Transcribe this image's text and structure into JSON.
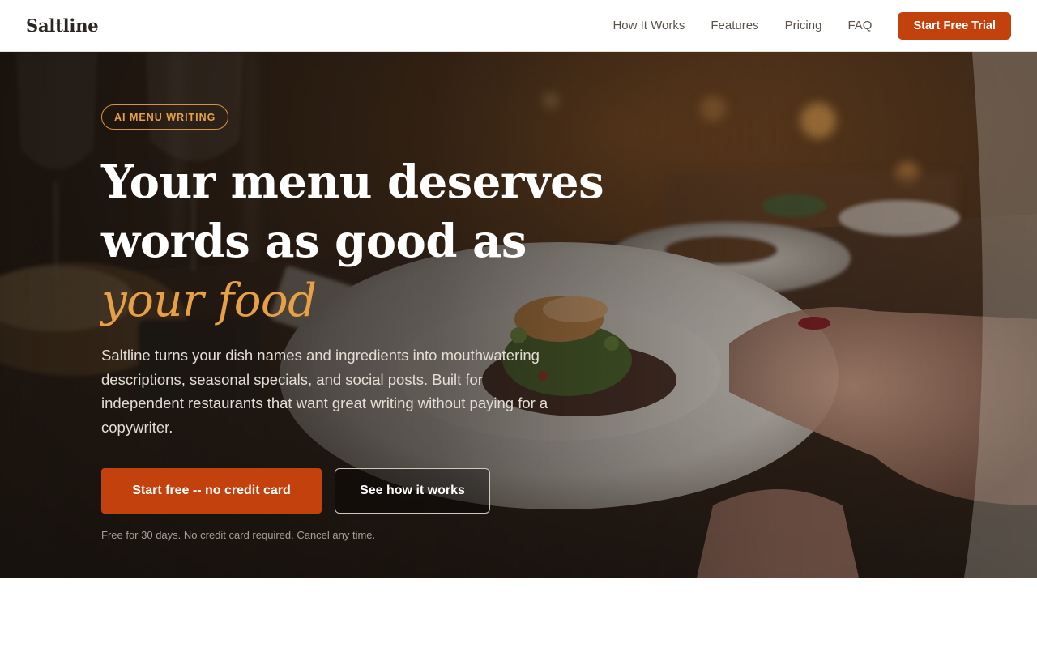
{
  "brand": {
    "name": "Saltline"
  },
  "nav": {
    "links": [
      "How It Works",
      "Features",
      "Pricing",
      "FAQ"
    ],
    "cta_label": "Start Free Trial"
  },
  "hero": {
    "badge": "AI MENU WRITING",
    "headline_line1": "Your menu deserves",
    "headline_line2": "words as good as",
    "headline_accent": "your food",
    "subcopy": "Saltline turns your dish names and ingredients into mouthwatering descriptions, seasonal specials, and social posts. Built for independent restaurants that want great writing without paying for a copywriter.",
    "primary_cta": "Start free -- no credit card",
    "secondary_cta": "See how it works",
    "fine_print": "Free for 30 days. No credit card required. Cancel any time.",
    "background_image": "restaurant-dinner-plate-photo"
  },
  "colors": {
    "accent": "#c2410c",
    "accent_text": "#e8a046",
    "nav_text": "#5b524a",
    "hero_overlay": "#16110d"
  }
}
